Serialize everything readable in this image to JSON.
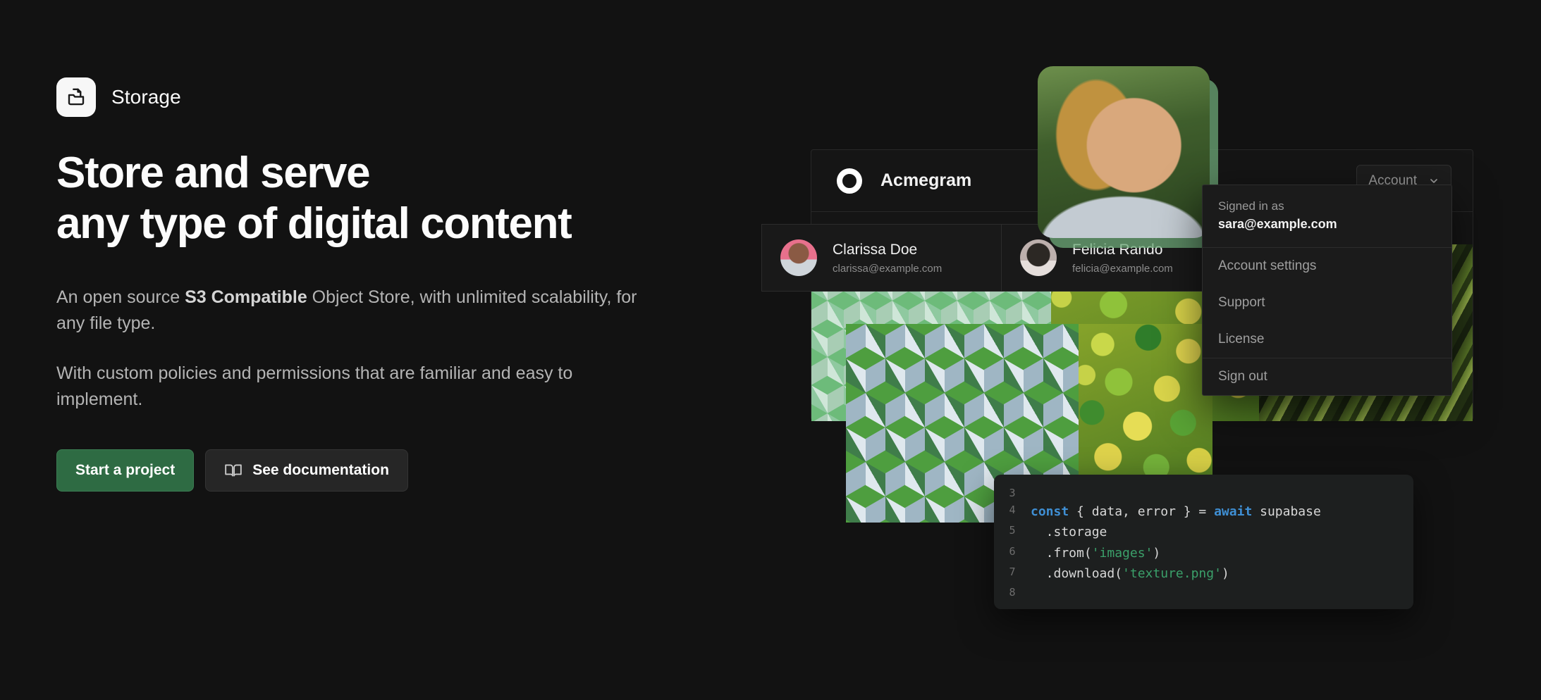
{
  "brand": {
    "name": "Storage",
    "icon": "archive-folder-icon"
  },
  "hero": {
    "headline": "Store and serve\nany type of digital content",
    "paragraph_1_pre": "An open source ",
    "paragraph_1_bold": "S3 Compatible",
    "paragraph_1_post": " Object Store, with unlimited scalability, for any file type.",
    "paragraph_2": "With custom policies and permissions that are familiar and easy to implement."
  },
  "cta": {
    "primary_label": "Start a project",
    "secondary_label": "See documentation",
    "secondary_icon": "book-open-icon",
    "primary_color": "#2e6b43",
    "secondary_color": "#262626"
  },
  "mockup": {
    "app": {
      "name": "Acmegram",
      "logo_icon": "circle-ring-icon",
      "account_button": {
        "label": "Account",
        "icon": "chevron-down-icon"
      }
    },
    "users": [
      {
        "name": "Clarissa Doe",
        "email": "clarissa@example.com",
        "avatar": "avatar-clarissa"
      },
      {
        "name": "Felicia Rando",
        "email": "felicia@example.com",
        "avatar": "avatar-felicia"
      }
    ],
    "account_menu": {
      "signed_in_label": "Signed in as",
      "signed_in_email": "sara@example.com",
      "items": [
        {
          "label": "Account settings"
        },
        {
          "label": "Support"
        },
        {
          "label": "License"
        },
        {
          "label": "Sign out",
          "separated": true
        }
      ]
    },
    "photos": [
      {
        "name": "woman-laughing-forest-photo"
      },
      {
        "name": "cube-texture-light-photo"
      },
      {
        "name": "cube-texture-photo"
      },
      {
        "name": "citrus-limes-photo"
      },
      {
        "name": "palm-frond-photo"
      }
    ],
    "code_block": {
      "lines": [
        {
          "num": "3",
          "tokens": []
        },
        {
          "num": "4",
          "tokens": [
            {
              "t": "const",
              "c": "kw"
            },
            {
              "t": " { data, error } = ",
              "c": "pl"
            },
            {
              "t": "await",
              "c": "kw"
            },
            {
              "t": " supabase",
              "c": "pl"
            }
          ]
        },
        {
          "num": "5",
          "tokens": [
            {
              "t": "  .storage",
              "c": "pl"
            }
          ]
        },
        {
          "num": "6",
          "tokens": [
            {
              "t": "  .from(",
              "c": "pl"
            },
            {
              "t": "'images'",
              "c": "str"
            },
            {
              "t": ")",
              "c": "pl"
            }
          ]
        },
        {
          "num": "7",
          "tokens": [
            {
              "t": "  .download(",
              "c": "pl"
            },
            {
              "t": "'texture.png'",
              "c": "str"
            },
            {
              "t": ")",
              "c": "pl"
            }
          ]
        },
        {
          "num": "8",
          "tokens": []
        }
      ]
    }
  }
}
